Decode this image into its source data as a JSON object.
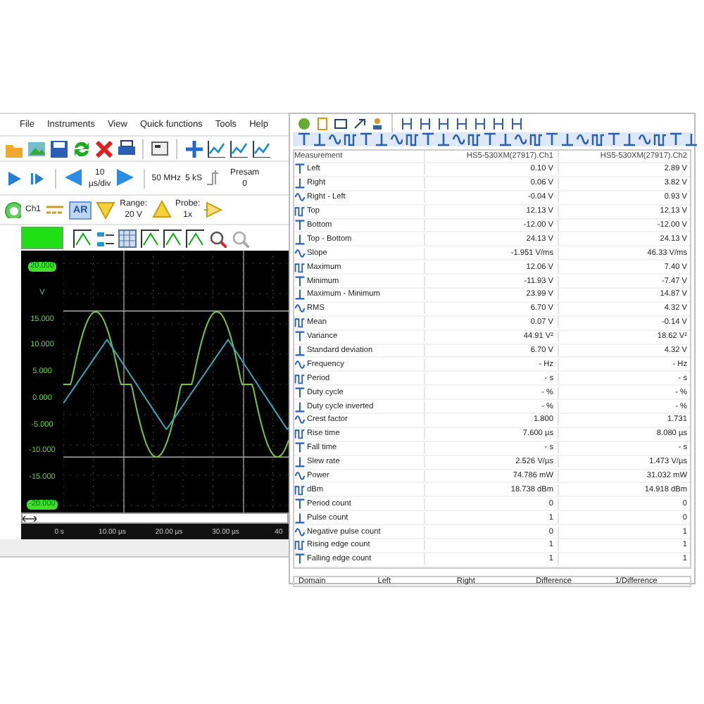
{
  "menu": [
    "File",
    "Instruments",
    "View",
    "Quick functions",
    "Tools",
    "Help"
  ],
  "acquisition_bar": {
    "timebase_value": "10",
    "timebase_unit": "µs/div",
    "sample_rate": "50 MHz",
    "record_length": "5 kS",
    "presample_label": "Presam",
    "presample_value": "0"
  },
  "channel_bar": {
    "channel": "Ch1",
    "auto_range": {
      "label": "AR",
      "selected": true
    },
    "range_label": "Range:",
    "range_value": "20 V",
    "probe_label": "Probe:",
    "probe_value": "1x"
  },
  "scope": {
    "top_value": "20.000",
    "unit": "V",
    "y_labels": [
      "15.000",
      "10.000",
      "5.000",
      "0.000",
      "-5.000",
      "-10.000",
      "-15.000"
    ],
    "bottom_value": "-20.000",
    "x_labels": [
      "0 s",
      "10.00 µs",
      "20.00 µs",
      "30.00 µs",
      "40"
    ]
  },
  "measurements": {
    "columns": [
      "Measurement",
      "HS5-530XM(27917).Ch1",
      "HS5-530XM(27917).Ch2"
    ],
    "rows": [
      {
        "name": "Left",
        "ch1": "0.10 V",
        "ch2": "2.89 V"
      },
      {
        "name": "Right",
        "ch1": "0.06 V",
        "ch2": "3.82 V"
      },
      {
        "name": "Right - Left",
        "ch1": "-0.04 V",
        "ch2": "0.93 V"
      },
      {
        "name": "Top",
        "ch1": "12.13 V",
        "ch2": "12.13 V"
      },
      {
        "name": "Bottom",
        "ch1": "-12.00 V",
        "ch2": "-12.00 V"
      },
      {
        "name": "Top - Bottom",
        "ch1": "24.13 V",
        "ch2": "24.13 V"
      },
      {
        "name": "Slope",
        "ch1": "-1.951 V/ms",
        "ch2": "46.33 V/ms"
      },
      {
        "name": "Maximum",
        "ch1": "12.06 V",
        "ch2": "7.40 V"
      },
      {
        "name": "Minimum",
        "ch1": "-11.93 V",
        "ch2": "-7.47 V"
      },
      {
        "name": "Maximum - Minimum",
        "ch1": "23.99 V",
        "ch2": "14.87 V"
      },
      {
        "name": "RMS",
        "ch1": "6.70 V",
        "ch2": "4.32 V"
      },
      {
        "name": "Mean",
        "ch1": "0.07 V",
        "ch2": "-0.14 V"
      },
      {
        "name": "Variance",
        "ch1": "44.91 V²",
        "ch2": "18.62 V²"
      },
      {
        "name": "Standard deviation",
        "ch1": "6.70 V",
        "ch2": "4.32 V"
      },
      {
        "name": "Frequency",
        "ch1": "- Hz",
        "ch2": "- Hz"
      },
      {
        "name": "Period",
        "ch1": "- s",
        "ch2": "- s"
      },
      {
        "name": "Duty cycle",
        "ch1": "- %",
        "ch2": "- %"
      },
      {
        "name": "Duty cycle inverted",
        "ch1": "- %",
        "ch2": "- %"
      },
      {
        "name": "Crest factor",
        "ch1": "1.800",
        "ch2": "1.731"
      },
      {
        "name": "Rise time",
        "ch1": "7.600 µs",
        "ch2": "8.080 µs"
      },
      {
        "name": "Fall time",
        "ch1": "- s",
        "ch2": "- s"
      },
      {
        "name": "Slew rate",
        "ch1": "2.526 V/µs",
        "ch2": "1.473 V/µs"
      },
      {
        "name": "Power",
        "ch1": "74.786 mW",
        "ch2": "31.032 mW"
      },
      {
        "name": "dBm",
        "ch1": "18.738 dBm",
        "ch2": "14.918 dBm"
      },
      {
        "name": "Period count",
        "ch1": "0",
        "ch2": "0"
      },
      {
        "name": "Pulse count",
        "ch1": "1",
        "ch2": "0"
      },
      {
        "name": "Negative pulse count",
        "ch1": "0",
        "ch2": "1"
      },
      {
        "name": "Rising edge count",
        "ch1": "1",
        "ch2": "1"
      },
      {
        "name": "Falling edge count",
        "ch1": "1",
        "ch2": "1"
      }
    ]
  },
  "cursor_table": {
    "columns": [
      "Domain",
      "Left",
      "Right",
      "Difference",
      "1/Difference"
    ]
  }
}
